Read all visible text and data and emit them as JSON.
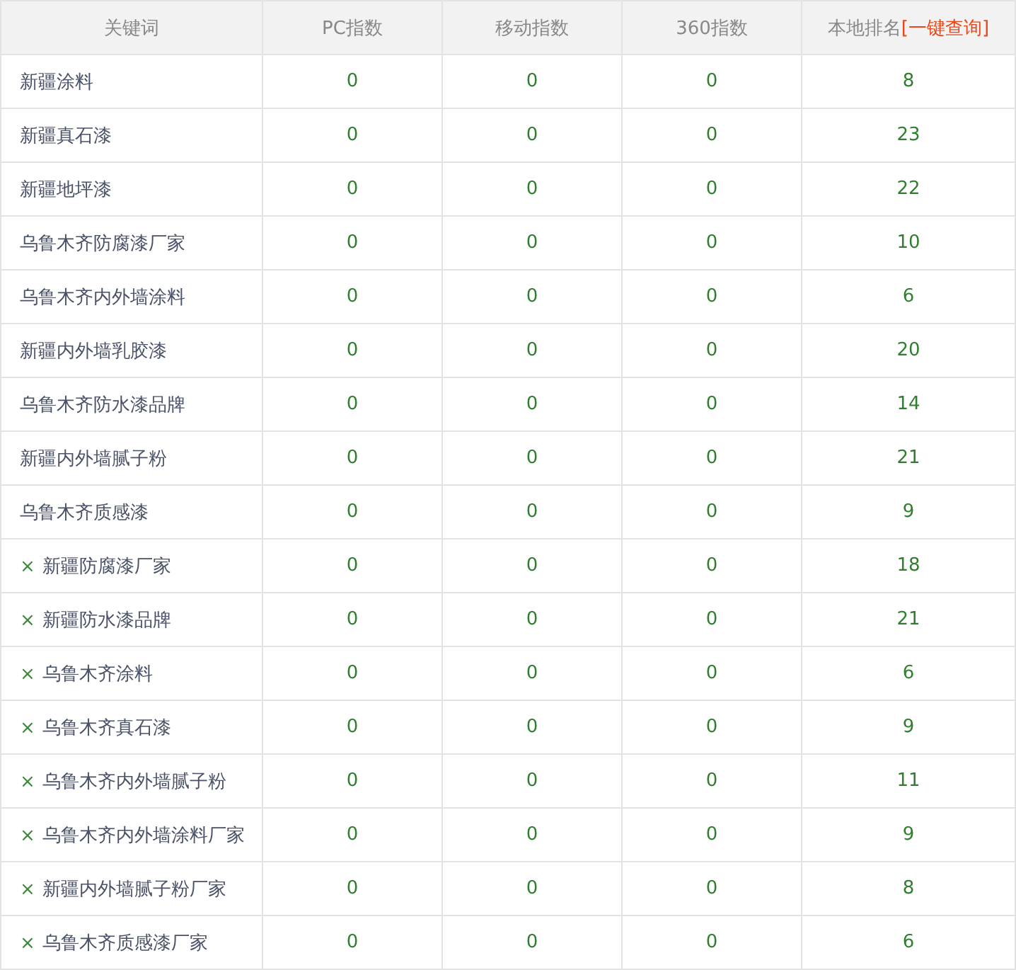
{
  "table": {
    "columns": [
      {
        "label": "关键词"
      },
      {
        "label": "PC指数"
      },
      {
        "label": "移动指数"
      },
      {
        "label": "360指数"
      },
      {
        "label": "本地排名",
        "link": "[一键查询]"
      }
    ],
    "rows": [
      {
        "keyword": "新疆涂料",
        "pc": "0",
        "mobile": "0",
        "so360": "0",
        "rank": "8"
      },
      {
        "keyword": "新疆真石漆",
        "pc": "0",
        "mobile": "0",
        "so360": "0",
        "rank": "23"
      },
      {
        "keyword": "新疆地坪漆",
        "pc": "0",
        "mobile": "0",
        "so360": "0",
        "rank": "22"
      },
      {
        "keyword": "乌鲁木齐防腐漆厂家",
        "pc": "0",
        "mobile": "0",
        "so360": "0",
        "rank": "10"
      },
      {
        "keyword": "乌鲁木齐内外墙涂料",
        "pc": "0",
        "mobile": "0",
        "so360": "0",
        "rank": "6"
      },
      {
        "keyword": "新疆内外墙乳胶漆",
        "pc": "0",
        "mobile": "0",
        "so360": "0",
        "rank": "20"
      },
      {
        "keyword": "乌鲁木齐防水漆品牌",
        "pc": "0",
        "mobile": "0",
        "so360": "0",
        "rank": "14"
      },
      {
        "keyword": "新疆内外墙腻子粉",
        "pc": "0",
        "mobile": "0",
        "so360": "0",
        "rank": "21"
      },
      {
        "keyword": "乌鲁木齐质感漆",
        "pc": "0",
        "mobile": "0",
        "so360": "0",
        "rank": "9"
      },
      {
        "remove": "×",
        "keyword": "新疆防腐漆厂家",
        "pc": "0",
        "mobile": "0",
        "so360": "0",
        "rank": "18"
      },
      {
        "remove": "×",
        "keyword": "新疆防水漆品牌",
        "pc": "0",
        "mobile": "0",
        "so360": "0",
        "rank": "21"
      },
      {
        "remove": "×",
        "keyword": "乌鲁木齐涂料",
        "pc": "0",
        "mobile": "0",
        "so360": "0",
        "rank": "6"
      },
      {
        "remove": "×",
        "keyword": "乌鲁木齐真石漆",
        "pc": "0",
        "mobile": "0",
        "so360": "0",
        "rank": "9"
      },
      {
        "remove": "×",
        "keyword": "乌鲁木齐内外墙腻子粉",
        "pc": "0",
        "mobile": "0",
        "so360": "0",
        "rank": "11"
      },
      {
        "remove": "×",
        "keyword": "乌鲁木齐内外墙涂料厂家",
        "pc": "0",
        "mobile": "0",
        "so360": "0",
        "rank": "9"
      },
      {
        "remove": "×",
        "keyword": "新疆内外墙腻子粉厂家",
        "pc": "0",
        "mobile": "0",
        "so360": "0",
        "rank": "8"
      },
      {
        "remove": "×",
        "keyword": "乌鲁木齐质感漆厂家",
        "pc": "0",
        "mobile": "0",
        "so360": "0",
        "rank": "6"
      }
    ]
  }
}
